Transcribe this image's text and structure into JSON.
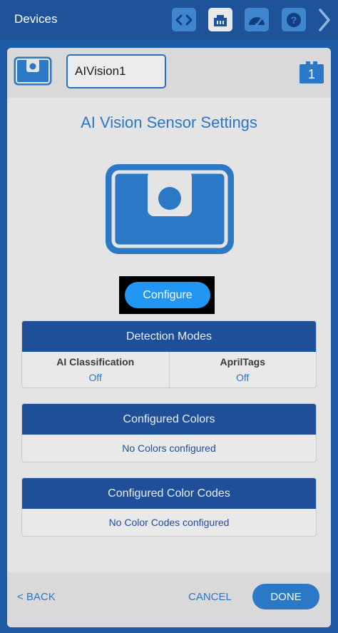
{
  "topbar": {
    "title": "Devices",
    "icons": [
      "code-icon",
      "devices-icon",
      "dashboard-icon",
      "help-icon",
      "chevron-right-icon"
    ]
  },
  "device": {
    "name": "AIVision1",
    "port": "1"
  },
  "settings": {
    "title": "AI Vision Sensor Settings",
    "configure_label": "Configure"
  },
  "detection_modes": {
    "title": "Detection Modes",
    "modes": [
      {
        "label": "AI Classification",
        "value": "Off"
      },
      {
        "label": "AprilTags",
        "value": "Off"
      }
    ]
  },
  "configured_colors": {
    "title": "Configured Colors",
    "message": "No Colors configured"
  },
  "configured_color_codes": {
    "title": "Configured Color Codes",
    "message": "No Color Codes configured"
  },
  "footer": {
    "back_label": "< BACK",
    "cancel_label": "CANCEL",
    "done_label": "DONE"
  },
  "colors": {
    "accent": "#2a78c6",
    "panel_header": "#1f4f98",
    "configure_button": "#2196f3"
  }
}
